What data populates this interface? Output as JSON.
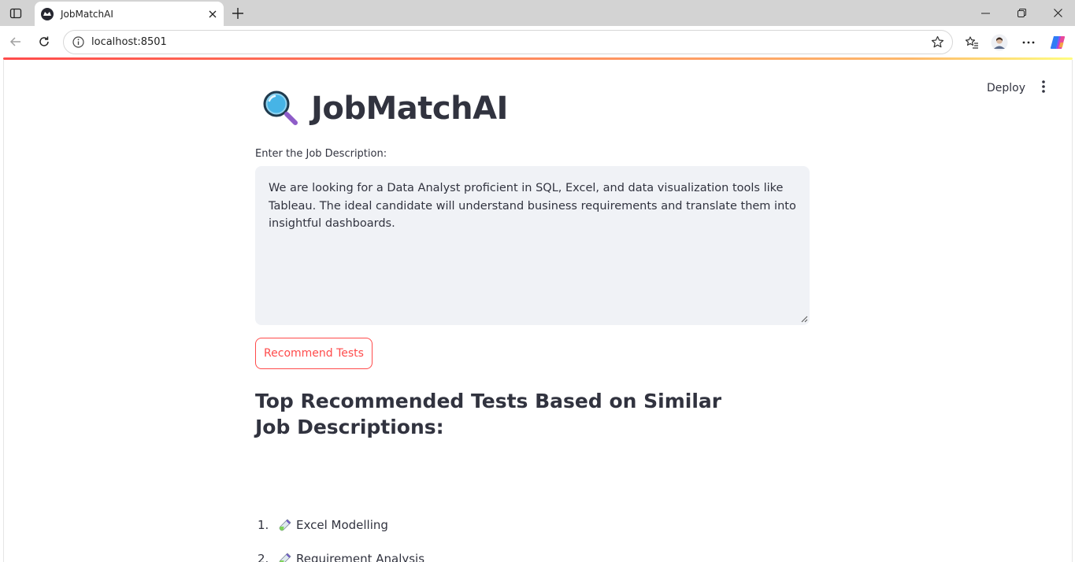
{
  "browser": {
    "tab_title": "JobMatchAI",
    "url": "localhost:8501"
  },
  "app": {
    "deploy_label": "Deploy",
    "title": "JobMatchAI",
    "title_icon": "magnifier-icon",
    "input_label": "Enter the Job Description:",
    "job_description": "We are looking for a Data Analyst proficient in SQL, Excel, and data visualization tools like Tableau. The ideal candidate will understand business requirements and translate them into insightful dashboards.",
    "button_label": "Recommend Tests",
    "results_heading": "Top Recommended Tests Based on Similar Job Descriptions:",
    "results": [
      {
        "num": "1.",
        "label": "Excel Modelling",
        "icon": "test-tube-icon"
      },
      {
        "num": "2.",
        "label": "Requirement Analysis",
        "icon": "test-tube-icon"
      }
    ]
  },
  "colors": {
    "accent": "#ff4b4b",
    "text": "#31333f",
    "input_bg": "#f0f2f6"
  }
}
